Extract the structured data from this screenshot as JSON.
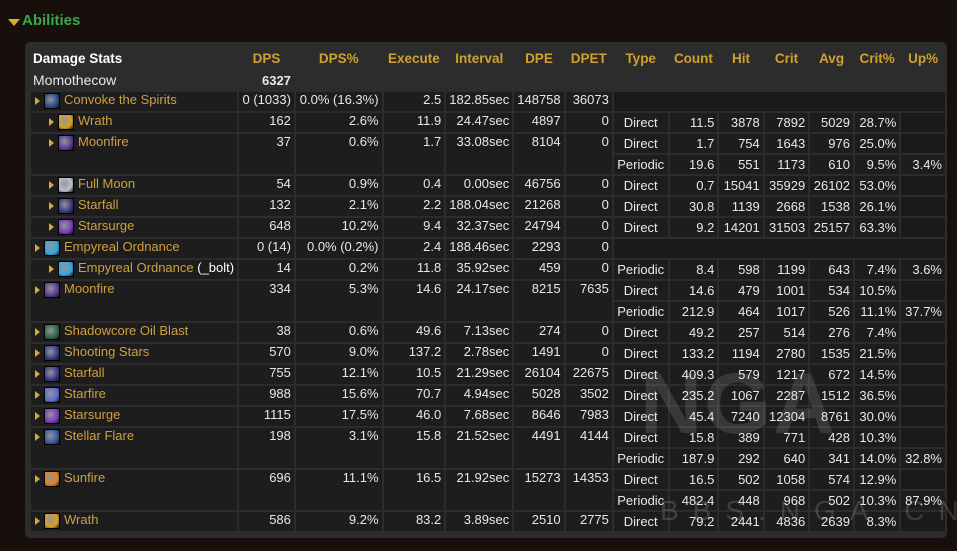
{
  "section": {
    "title": "Abilities"
  },
  "headers": [
    "Damage Stats",
    "DPS",
    "DPS%",
    "Execute",
    "Interval",
    "DPE",
    "DPET",
    "Type",
    "Count",
    "Hit",
    "Crit",
    "Avg",
    "Crit%",
    "Up%"
  ],
  "player": {
    "name": "Momothecow",
    "dps": "6327"
  },
  "watermark": {
    "logo": "NGA",
    "site": "BBS.NGA.CN"
  },
  "abilities": [
    {
      "name": "Convoke the Spirits",
      "level": 0,
      "icon": "convoke-icon",
      "icon_color": "#2a4a8a",
      "dps": "0 (1033)",
      "dps_pct": "0.0% (16.3%)",
      "execute": "2.5",
      "interval": "182.85sec",
      "dpe": "148758",
      "dpet": "36073",
      "results": []
    },
    {
      "name": "Wrath",
      "level": 1,
      "icon": "wrath-icon",
      "icon_color": "#d8a020",
      "dps": "162",
      "dps_pct": "2.6%",
      "execute": "11.9",
      "interval": "24.47sec",
      "dpe": "4897",
      "dpet": "0",
      "results": [
        {
          "type": "Direct",
          "count": "11.5",
          "hit": "3878",
          "crit": "7892",
          "avg": "5029",
          "crit_pct": "28.7%",
          "up_pct": ""
        }
      ]
    },
    {
      "name": "Moonfire",
      "level": 1,
      "icon": "moonfire-icon",
      "icon_color": "#5a3a9a",
      "dps": "37",
      "dps_pct": "0.6%",
      "execute": "1.7",
      "interval": "33.08sec",
      "dpe": "8104",
      "dpet": "0",
      "results": [
        {
          "type": "Direct",
          "count": "1.7",
          "hit": "754",
          "crit": "1643",
          "avg": "976",
          "crit_pct": "25.0%",
          "up_pct": ""
        },
        {
          "type": "Periodic",
          "count": "19.6",
          "hit": "551",
          "crit": "1173",
          "avg": "610",
          "crit_pct": "9.5%",
          "up_pct": "3.4%"
        }
      ]
    },
    {
      "name": "Full Moon",
      "level": 1,
      "icon": "full-moon-icon",
      "icon_color": "#b8c0d0",
      "dps": "54",
      "dps_pct": "0.9%",
      "execute": "0.4",
      "interval": "0.00sec",
      "dpe": "46756",
      "dpet": "0",
      "results": [
        {
          "type": "Direct",
          "count": "0.7",
          "hit": "15041",
          "crit": "35929",
          "avg": "26102",
          "crit_pct": "53.0%",
          "up_pct": ""
        }
      ]
    },
    {
      "name": "Starfall",
      "level": 1,
      "icon": "starfall-icon",
      "icon_color": "#3a3a8a",
      "dps": "132",
      "dps_pct": "2.1%",
      "execute": "2.2",
      "interval": "188.04sec",
      "dpe": "21268",
      "dpet": "0",
      "results": [
        {
          "type": "Direct",
          "count": "30.8",
          "hit": "1139",
          "crit": "2668",
          "avg": "1538",
          "crit_pct": "26.1%",
          "up_pct": ""
        }
      ]
    },
    {
      "name": "Starsurge",
      "level": 1,
      "icon": "starsurge-icon",
      "icon_color": "#7a3ac0",
      "dps": "648",
      "dps_pct": "10.2%",
      "execute": "9.4",
      "interval": "32.37sec",
      "dpe": "24794",
      "dpet": "0",
      "results": [
        {
          "type": "Direct",
          "count": "9.2",
          "hit": "14201",
          "crit": "31503",
          "avg": "25157",
          "crit_pct": "63.3%",
          "up_pct": ""
        }
      ]
    },
    {
      "name": "Empyreal Ordnance",
      "level": 0,
      "icon": "empyreal-ordnance-icon",
      "icon_color": "#30a8e0",
      "dps": "0 (14)",
      "dps_pct": "0.0% (0.2%)",
      "execute": "2.4",
      "interval": "188.46sec",
      "dpe": "2293",
      "dpet": "0",
      "results": []
    },
    {
      "name": "Empyreal Ordnance",
      "suffix": " (_bolt)",
      "level": 1,
      "icon": "empyreal-ordnance-icon",
      "icon_color": "#30a8e0",
      "dps": "14",
      "dps_pct": "0.2%",
      "execute": "11.8",
      "interval": "35.92sec",
      "dpe": "459",
      "dpet": "0",
      "results": [
        {
          "type": "Periodic",
          "count": "8.4",
          "hit": "598",
          "crit": "1199",
          "avg": "643",
          "crit_pct": "7.4%",
          "up_pct": "3.6%"
        }
      ]
    },
    {
      "name": "Moonfire",
      "level": 0,
      "icon": "moonfire-icon",
      "icon_color": "#5a3a9a",
      "dps": "334",
      "dps_pct": "5.3%",
      "execute": "14.6",
      "interval": "24.17sec",
      "dpe": "8215",
      "dpet": "7635",
      "results": [
        {
          "type": "Direct",
          "count": "14.6",
          "hit": "479",
          "crit": "1001",
          "avg": "534",
          "crit_pct": "10.5%",
          "up_pct": ""
        },
        {
          "type": "Periodic",
          "count": "212.9",
          "hit": "464",
          "crit": "1017",
          "avg": "526",
          "crit_pct": "11.1%",
          "up_pct": "37.7%"
        }
      ]
    },
    {
      "name": "Shadowcore Oil Blast",
      "level": 0,
      "icon": "shadowcore-oil-icon",
      "icon_color": "#2a6a4a",
      "dps": "38",
      "dps_pct": "0.6%",
      "execute": "49.6",
      "interval": "7.13sec",
      "dpe": "274",
      "dpet": "0",
      "results": [
        {
          "type": "Direct",
          "count": "49.2",
          "hit": "257",
          "crit": "514",
          "avg": "276",
          "crit_pct": "7.4%",
          "up_pct": ""
        }
      ]
    },
    {
      "name": "Shooting Stars",
      "level": 0,
      "icon": "shooting-stars-icon",
      "icon_color": "#3a3a8a",
      "dps": "570",
      "dps_pct": "9.0%",
      "execute": "137.2",
      "interval": "2.78sec",
      "dpe": "1491",
      "dpet": "0",
      "results": [
        {
          "type": "Direct",
          "count": "133.2",
          "hit": "1194",
          "crit": "2780",
          "avg": "1535",
          "crit_pct": "21.5%",
          "up_pct": ""
        }
      ]
    },
    {
      "name": "Starfall",
      "level": 0,
      "icon": "starfall-icon",
      "icon_color": "#3a3a8a",
      "dps": "755",
      "dps_pct": "12.1%",
      "execute": "10.5",
      "interval": "21.29sec",
      "dpe": "26104",
      "dpet": "22675",
      "results": [
        {
          "type": "Direct",
          "count": "409.3",
          "hit": "579",
          "crit": "1217",
          "avg": "672",
          "crit_pct": "14.5%",
          "up_pct": ""
        }
      ]
    },
    {
      "name": "Starfire",
      "level": 0,
      "icon": "starfire-icon",
      "icon_color": "#5a6ad0",
      "dps": "988",
      "dps_pct": "15.6%",
      "execute": "70.7",
      "interval": "4.94sec",
      "dpe": "5028",
      "dpet": "3502",
      "results": [
        {
          "type": "Direct",
          "count": "235.2",
          "hit": "1067",
          "crit": "2287",
          "avg": "1512",
          "crit_pct": "36.5%",
          "up_pct": ""
        }
      ]
    },
    {
      "name": "Starsurge",
      "level": 0,
      "icon": "starsurge-icon",
      "icon_color": "#7a3ac0",
      "dps": "1115",
      "dps_pct": "17.5%",
      "execute": "46.0",
      "interval": "7.68sec",
      "dpe": "8646",
      "dpet": "7983",
      "results": [
        {
          "type": "Direct",
          "count": "45.4",
          "hit": "7240",
          "crit": "12304",
          "avg": "8761",
          "crit_pct": "30.0%",
          "up_pct": ""
        }
      ]
    },
    {
      "name": "Stellar Flare",
      "level": 0,
      "icon": "stellar-flare-icon",
      "icon_color": "#3a5aa0",
      "dps": "198",
      "dps_pct": "3.1%",
      "execute": "15.8",
      "interval": "21.52sec",
      "dpe": "4491",
      "dpet": "4144",
      "results": [
        {
          "type": "Direct",
          "count": "15.8",
          "hit": "389",
          "crit": "771",
          "avg": "428",
          "crit_pct": "10.3%",
          "up_pct": ""
        },
        {
          "type": "Periodic",
          "count": "187.9",
          "hit": "292",
          "crit": "640",
          "avg": "341",
          "crit_pct": "14.0%",
          "up_pct": "32.8%"
        }
      ]
    },
    {
      "name": "Sunfire",
      "level": 0,
      "icon": "sunfire-icon",
      "icon_color": "#e08020",
      "dps": "696",
      "dps_pct": "11.1%",
      "execute": "16.5",
      "interval": "21.92sec",
      "dpe": "15273",
      "dpet": "14353",
      "results": [
        {
          "type": "Direct",
          "count": "16.5",
          "hit": "502",
          "crit": "1058",
          "avg": "574",
          "crit_pct": "12.9%",
          "up_pct": ""
        },
        {
          "type": "Periodic",
          "count": "482.4",
          "hit": "448",
          "crit": "968",
          "avg": "502",
          "crit_pct": "10.3%",
          "up_pct": "87.9%"
        }
      ]
    },
    {
      "name": "Wrath",
      "level": 0,
      "icon": "wrath-icon",
      "icon_color": "#d8a020",
      "dps": "586",
      "dps_pct": "9.2%",
      "execute": "83.2",
      "interval": "3.89sec",
      "dpe": "2510",
      "dpet": "2775",
      "results": [
        {
          "type": "Direct",
          "count": "79.2",
          "hit": "2441",
          "crit": "4836",
          "avg": "2639",
          "crit_pct": "8.3%",
          "up_pct": ""
        }
      ]
    }
  ]
}
